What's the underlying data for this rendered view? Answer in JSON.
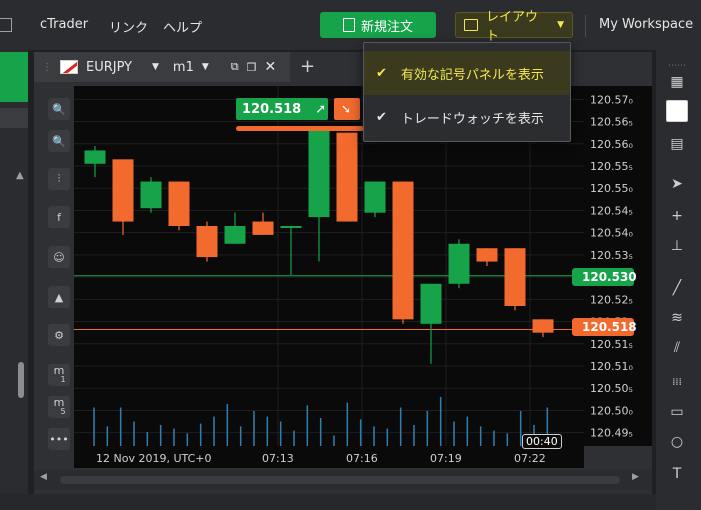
{
  "topbar": {
    "brand": "cTrader",
    "menu_link": "リンク",
    "menu_help": "ヘルプ",
    "new_order_label": "新規注文",
    "layout_label": "レイアウト",
    "workspace_label": "My Workspace"
  },
  "tab": {
    "symbol": "EURJPY",
    "timeframe": "m1"
  },
  "dropdown": {
    "items": [
      {
        "label": "有効な記号パネルを表示",
        "checked": true,
        "highlighted": true
      },
      {
        "label": "トレードウォッチを表示",
        "checked": true,
        "highlighted": false
      }
    ]
  },
  "quote": {
    "buy_price": "120.518",
    "buy_color": "#16a34a",
    "sell_color": "#f26a2e"
  },
  "chart": {
    "date_label": "12 Nov 2019, UTC+0",
    "cursor_time": "00:40",
    "current_bid": "120.530",
    "current_ask": "120.518",
    "toolbar_m1_label": "m",
    "toolbar_m1_sub": "1",
    "toolbar_m5_label": "m",
    "toolbar_m5_sub": "5"
  },
  "chart_data": {
    "type": "candlestick",
    "price_ticks": [
      "120.57₀",
      "120.56₅",
      "120.56₀",
      "120.55₅",
      "120.55₀",
      "120.54₅",
      "120.54₀",
      "120.53₅",
      "120.53₀",
      "120.52₅",
      "120.52₀",
      "120.51₅",
      "120.51₀",
      "120.50₅",
      "120.50₀",
      "120.49₅"
    ],
    "time_ticks": [
      "07:13",
      "07:16",
      "07:19",
      "07:22"
    ],
    "ylim": [
      120.492,
      120.573
    ],
    "candles": [
      {
        "o": 120.5555,
        "h": 120.5595,
        "l": 120.5525,
        "c": 120.5585
      },
      {
        "o": 120.5565,
        "h": 120.5565,
        "l": 120.5395,
        "c": 120.5425
      },
      {
        "o": 120.5455,
        "h": 120.5525,
        "l": 120.5445,
        "c": 120.5515
      },
      {
        "o": 120.5515,
        "h": 120.5515,
        "l": 120.5405,
        "c": 120.5415
      },
      {
        "o": 120.5415,
        "h": 120.5425,
        "l": 120.5335,
        "c": 120.5345
      },
      {
        "o": 120.5375,
        "h": 120.5445,
        "l": 120.5375,
        "c": 120.5415
      },
      {
        "o": 120.5425,
        "h": 120.5445,
        "l": 120.5395,
        "c": 120.5395
      },
      {
        "o": 120.5415,
        "h": 120.5415,
        "l": 120.5305,
        "c": 120.5415
      },
      {
        "o": 120.5435,
        "h": 120.5625,
        "l": 120.5335,
        "c": 120.5635
      },
      {
        "o": 120.5625,
        "h": 120.5625,
        "l": 120.5425,
        "c": 120.5425
      },
      {
        "o": 120.5445,
        "h": 120.5515,
        "l": 120.5435,
        "c": 120.5515
      },
      {
        "o": 120.5515,
        "h": 120.5515,
        "l": 120.5195,
        "c": 120.5205
      },
      {
        "o": 120.5195,
        "h": 120.5285,
        "l": 120.5105,
        "c": 120.5285
      },
      {
        "o": 120.5285,
        "h": 120.5385,
        "l": 120.5275,
        "c": 120.5375
      },
      {
        "o": 120.5365,
        "h": 120.5365,
        "l": 120.5325,
        "c": 120.5335
      },
      {
        "o": 120.5365,
        "h": 120.5365,
        "l": 120.5225,
        "c": 120.5235
      },
      {
        "o": 120.5205,
        "h": 120.5205,
        "l": 120.5165,
        "c": 120.5175
      }
    ],
    "volume_bars": [
      0.55,
      0.28,
      0.55,
      0.35,
      0.2,
      0.3,
      0.25,
      0.18,
      0.32,
      0.42,
      0.6,
      0.28,
      0.5,
      0.42,
      0.35,
      0.22,
      0.58,
      0.4,
      0.15,
      0.62,
      0.38,
      0.28,
      0.25,
      0.55,
      0.3,
      0.5,
      0.7,
      0.35,
      0.42,
      0.28,
      0.22,
      0.18,
      0.5,
      0.3,
      0.55,
      0.12
    ],
    "volume_color": "#2f7fb5",
    "bull_color": "#16a34a",
    "bear_color": "#f26a2e",
    "bid_line": 120.5303,
    "ask_line": 120.5182
  }
}
